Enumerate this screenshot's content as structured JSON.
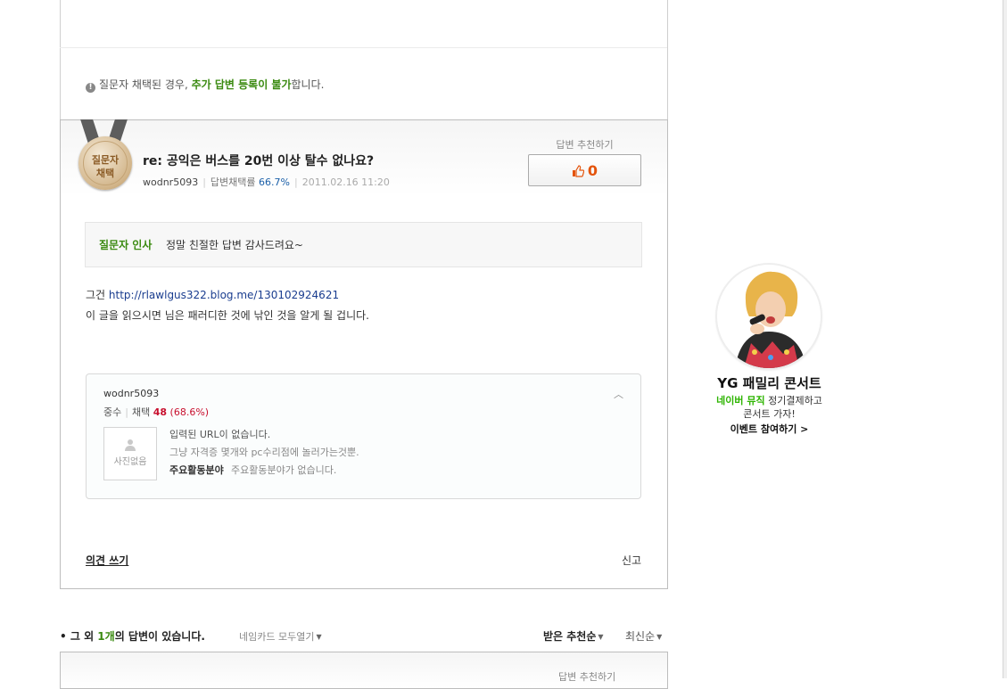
{
  "notice": {
    "icon": "info-icon",
    "prefix": "질문자 채택된 경우, ",
    "highlight": "추가 답변 등록이 불가",
    "suffix": "합니다."
  },
  "answer": {
    "medal_line1": "질문자",
    "medal_line2": "채택",
    "title": "re: 공익은 버스를 20번 이상 탈수 없나요?",
    "author": "wodnr5093",
    "rate_label": "답변채택률",
    "rate_value": "66.7%",
    "date": "2011.02.16 11:20",
    "recommend_label": "답변 추천하기",
    "recommend_count": "0",
    "greeting_label": "질문자 인사",
    "greeting_text": "정말 친절한 답변 감사드려요~",
    "body_prefix": "그건 ",
    "body_link": "http://rlawlgus322.blog.me/130102924621",
    "body_line2": "이 글을 읽으시면 님은 패러디한 것에 낚인 것을 알게 될 겁니다."
  },
  "namecard": {
    "user": "wodnr5093",
    "collapse_glyph": "︿",
    "grade": "중수",
    "adopt_label": "채택",
    "adopt_count": "48",
    "adopt_pct": "(68.6%)",
    "photo_text": "사진없음",
    "url_text": "입력된 URL이 없습니다.",
    "desc": "그냥 자격증 몇개와 pc수리점에 놀러가는것뿐.",
    "activity_label": "주요활동분야",
    "activity_value": "주요활동분야가 없습니다."
  },
  "actions": {
    "comment": "의견 쓰기",
    "report": "신고"
  },
  "others": {
    "bullet": "•",
    "prefix": "그 외 ",
    "count": "1개",
    "suffix": "의 답변이 있습니다.",
    "namecard_all": "네임카드 모두열기",
    "sort_recommend": "받은 추천순",
    "sort_latest": "최신순",
    "next_recommend_label": "답변 추천하기"
  },
  "ad": {
    "title": "YG 패밀리 콘서트",
    "sub1_green": "네이버 뮤직",
    "sub1_rest": " 정기결제하고",
    "sub2": "콘서트 가자!",
    "link": "이벤트 참여하기 >"
  },
  "colors": {
    "accent_green": "#3a8a10",
    "recommend_orange": "#e4540c",
    "link_blue": "#1a3d8f",
    "naver_green": "#2db400"
  }
}
